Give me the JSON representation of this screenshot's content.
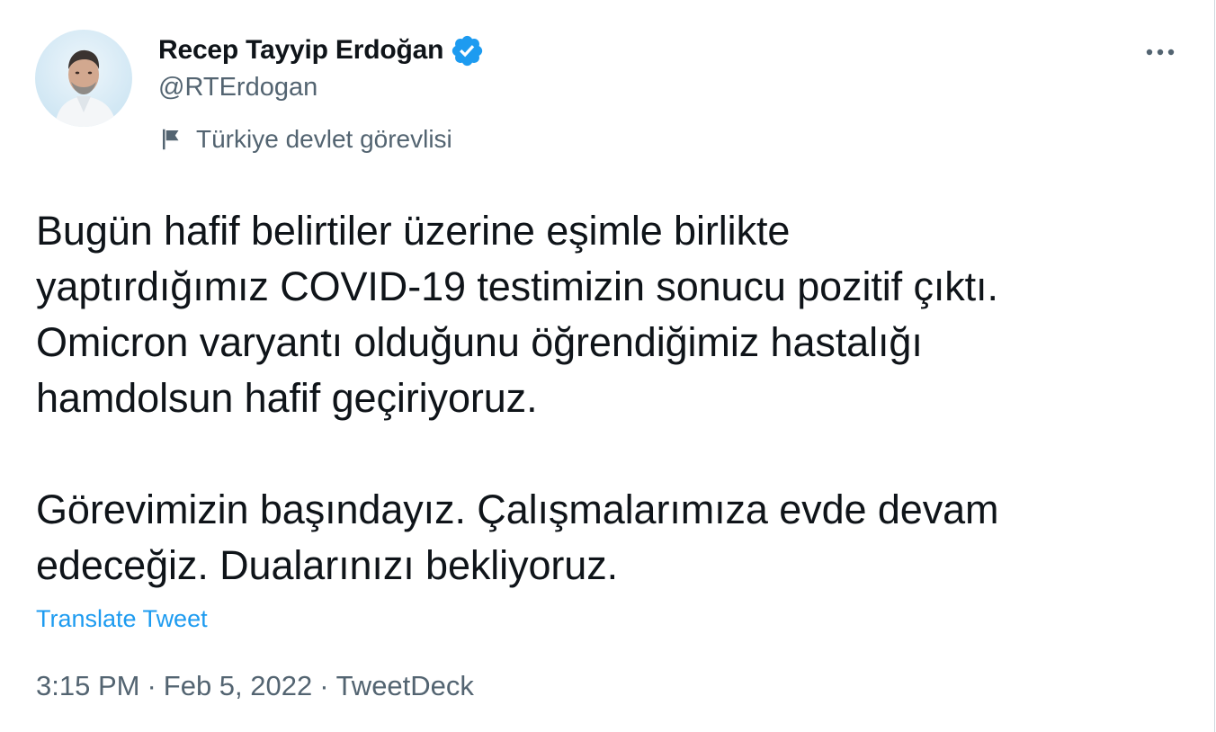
{
  "author": {
    "display_name": "Recep Tayyip Erdoğan",
    "handle": "@RTErdogan",
    "verified": true,
    "affiliation_label": "Türkiye devlet görevlisi",
    "avatar_icon": "profile-photo",
    "badge_icon": "verified-badge-icon",
    "affiliation_icon": "flag-icon"
  },
  "tweet": {
    "paragraph_1": "Bugün hafif belirtiler üzerine eşimle birlikte\nyaptırdığımız COVID-19 testimizin sonucu pozitif çıktı.\nOmicron varyantı olduğunu öğrendiğimiz hastalığı\nhamdolsun hafif geçiriyoruz.",
    "paragraph_2": "Görevimizin başındayız. Çalışmalarımıza evde devam\nedeceğiz. Dualarınızı bekliyoruz.",
    "translate_label": "Translate Tweet"
  },
  "meta": {
    "time": "3:15 PM",
    "date": "Feb 5, 2022",
    "separator": "·",
    "source": "TweetDeck"
  },
  "more_menu_icon": "more-horizontal-icon",
  "colors": {
    "text_primary": "#0f1419",
    "text_secondary": "#536471",
    "link": "#1d9bf0",
    "badge": "#1d9bf0"
  }
}
